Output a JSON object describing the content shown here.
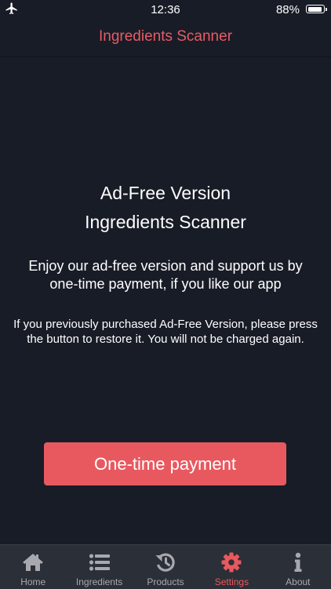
{
  "status": {
    "time": "12:36",
    "battery": "88%"
  },
  "nav": {
    "title": "Ingredients Scanner"
  },
  "content": {
    "heading_line1": "Ad-Free Version",
    "heading_line2": "Ingredients Scanner",
    "subtitle": "Enjoy our ad-free version and support us by one-time payment, if you like our app",
    "notice": "If you previously purchased Ad-Free Version, please press the button to restore it. You will not be charged again.",
    "button_label": "One-time payment"
  },
  "tabs": [
    {
      "label": "Home",
      "icon": "home-icon"
    },
    {
      "label": "Ingredients",
      "icon": "list-icon"
    },
    {
      "label": "Products",
      "icon": "history-icon"
    },
    {
      "label": "Settings",
      "icon": "gear-icon",
      "active": true
    },
    {
      "label": "About",
      "icon": "info-icon"
    }
  ],
  "colors": {
    "accent": "#e8595f",
    "background": "#181c27",
    "tabbar": "#2b2f37"
  }
}
